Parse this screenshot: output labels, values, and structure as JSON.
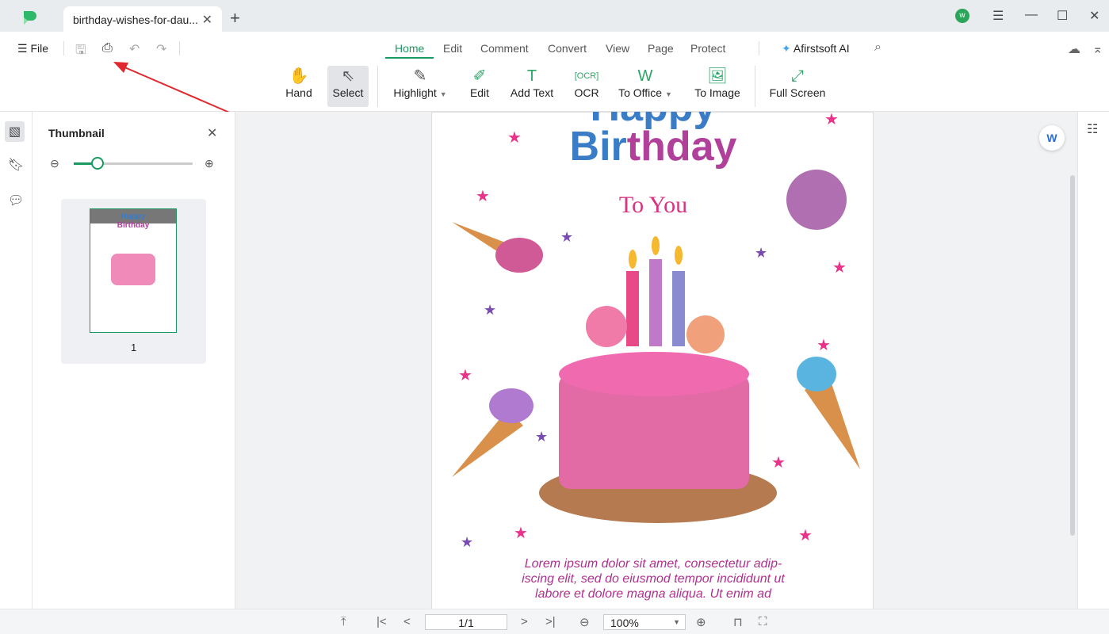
{
  "app": {
    "tab_title": "birthday-wishes-for-dau...",
    "avatar_letter": "w",
    "accent": "#1a9a62"
  },
  "toolbar": {
    "file_label": "File",
    "menu": [
      {
        "label": "Home",
        "active": true
      },
      {
        "label": "Edit"
      },
      {
        "label": "Comment"
      },
      {
        "label": "Convert"
      },
      {
        "label": "View"
      },
      {
        "label": "Page"
      },
      {
        "label": "Protect"
      }
    ],
    "ai_label": "Afirstsoft AI",
    "tools": {
      "hand": "Hand",
      "select": "Select",
      "highlight": "Highlight",
      "edit": "Edit",
      "add_text": "Add Text",
      "ocr": "OCR",
      "to_office": "To Office",
      "to_image": "To Image",
      "full_screen": "Full Screen"
    }
  },
  "thumbnail": {
    "title": "Thumbnail",
    "zoom_level": 0.2,
    "pages": [
      {
        "number": "1"
      }
    ]
  },
  "document": {
    "title_line1": "Happy",
    "title_line2": "Birthday",
    "subtitle": "To You",
    "body": [
      "Lorem ipsum dolor sit amet, consectetur adip-",
      "iscing elit, sed do eiusmod tempor incididunt ut",
      "labore et dolore magna aliqua. Ut enim ad"
    ]
  },
  "status": {
    "page": "1/1",
    "zoom": "100%"
  }
}
